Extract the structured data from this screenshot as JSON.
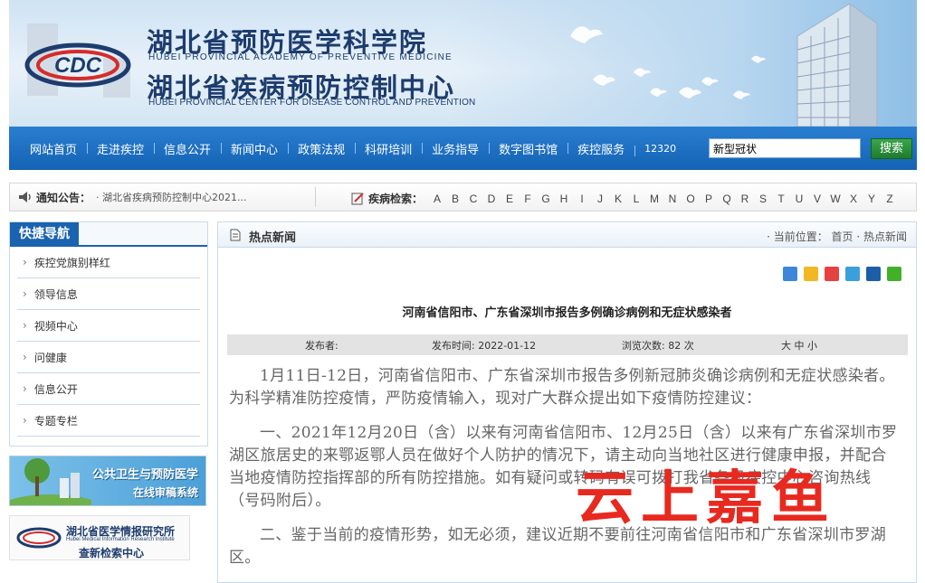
{
  "header": {
    "title_cn_1": "湖北省预防医学科学院",
    "title_en_1": "HUBEI PROVINCIAL ACADEMY OF PREVENTIVE MEDICINE",
    "title_cn_2": "湖北省疾病预防控制中心",
    "title_en_2": "HUBEI PROVINCIAL CENTER FOR DISEASE CONTROL AND PREVENTION",
    "logo_text": "CDC"
  },
  "nav": {
    "items": [
      "网站首页",
      "走进疾控",
      "信息公开",
      "新闻中心",
      "政策法规",
      "科研培训",
      "业务指导",
      "数字图书馆",
      "疾控服务",
      "12320"
    ],
    "search_value": "新型冠状",
    "search_button": "搜索"
  },
  "notice": {
    "label": "通知公告：",
    "text": "· 湖北省疾病预防控制中心2021...",
    "disease_label": "疾病检索：",
    "letters": [
      "A",
      "B",
      "C",
      "D",
      "E",
      "F",
      "G",
      "H",
      "I",
      "J",
      "K",
      "L",
      "M",
      "N",
      "O",
      "P",
      "Q",
      "R",
      "S",
      "T",
      "U",
      "V",
      "W",
      "X",
      "Y",
      "Z"
    ]
  },
  "sidebar": {
    "title": "快捷导航",
    "items": [
      "疾控党旗别样红",
      "领导信息",
      "视频中心",
      "问健康",
      "信息公开",
      "专题专栏"
    ]
  },
  "banners": {
    "b1_line1": "公共卫生与预防医学",
    "b1_line2": "在线审稿系统",
    "b2_line1": "湖北省医学情报研究所",
    "b2_line1_en": "Hubei Medical Information Research Institute",
    "b2_line2": "查新检索中心"
  },
  "main": {
    "section_title": "热点新闻",
    "location": "· 当前位置： 首页 · 热点新闻",
    "article_title": "河南省信阳市、广东省深圳市报告多例确诊病例和无症状感染者",
    "meta": {
      "publisher": "发布者:",
      "date": "发布时间: 2022-01-12",
      "views": "浏览次数: 82 次",
      "font_size": "大 中 小"
    },
    "paragraphs": [
      "1月11日-12日，河南省信阳市、广东省深圳市报告多例新冠肺炎确诊病例和无症状感染者。为科学精准防控疫情，严防疫情输入，现对广大群众提出如下疫情防控建议：",
      "一、2021年12月20日（含）以来有河南省信阳市、12月25日（含）以来有广东省深圳市罗湖区旅居史的来鄂返鄂人员在做好个人防护的情况下，请主动向当地社区进行健康申报，并配合当地疫情防控指挥部的所有防控措施。如有疑问或转码有误可拨打我省各级疾控中心咨询热线（号码附后）。",
      "二、鉴于当前的疫情形势，如无必须，建议近期不要前往河南省信阳市和广东省深圳市罗湖区。"
    ]
  },
  "watermark": "云上嘉鱼",
  "colors": {
    "nav_blue": "#1a6cc0",
    "title_blue": "#1d3c6e",
    "watermark_red": "#e8291f"
  }
}
